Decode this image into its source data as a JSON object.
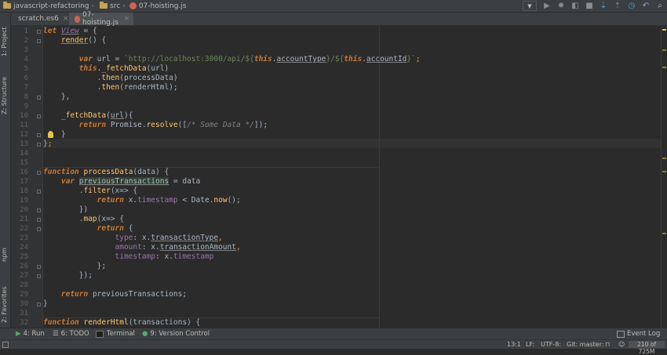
{
  "breadcrumb": {
    "project": "javascript-refactoring",
    "folder": "src",
    "file": "07-hoisting.js"
  },
  "tabs": [
    {
      "label": "scratch.es6",
      "icon": "es6-file-icon"
    },
    {
      "label": "07-hoisting.js",
      "icon": "js-file-icon"
    }
  ],
  "left_tools": {
    "project": "1: Project",
    "structure": "Z: Structure",
    "npm": "npm",
    "favorites": "2: Favorites"
  },
  "line_numbers": [
    "1",
    "2",
    "3",
    "4",
    "5",
    "6",
    "7",
    "8",
    "9",
    "10",
    "11",
    "12",
    "13",
    "14",
    "15",
    "16",
    "17",
    "18",
    "19",
    "20",
    "21",
    "22",
    "23",
    "24",
    "25",
    "26",
    "27",
    "28",
    "29",
    "30",
    "31",
    "32"
  ],
  "code": {
    "l1_a": "let ",
    "l1_b": "View",
    "l1_c": " = {",
    "l2_a": "    ",
    "l2_b": "render",
    "l2_c": "() {",
    "l4_a": "        ",
    "l4_b": "var",
    "l4_c": " url = ",
    "l4_d": "`http://localhost:3000/api/${",
    "l4_e": "this",
    "l4_f": ".",
    "l4_g": "accountType",
    "l4_h": "}/${",
    "l4_i": "this",
    "l4_j": ".",
    "l4_k": "accountId",
    "l4_l": "}`",
    "l4_m": ";",
    "l5_a": "        ",
    "l5_b": "this",
    "l5_c": ".",
    "l5_d": "_fetchData",
    "l5_e": "(url)",
    "l6_a": "            .",
    "l6_b": "then",
    "l6_c": "(processData)",
    "l7_a": "            .",
    "l7_b": "then",
    "l7_c": "(renderHtml);",
    "l8": "    },",
    "l10_a": "    ",
    "l10_b": "_fetchData",
    "l10_c": "(",
    "l10_d": "url",
    "l10_e": "){",
    "l11_a": "        ",
    "l11_b": "return",
    "l11_c": " Promise.",
    "l11_d": "resolve",
    "l11_e": "([",
    "l11_f": "/* Some Data */",
    "l11_g": "]);",
    "l12": "    }",
    "l13_a": "}",
    "l13_b": ";",
    "l16_a": "function",
    "l16_b": " ",
    "l16_c": "processData",
    "l16_d": "(data) {",
    "l17_a": "    ",
    "l17_b": "var",
    "l17_c": " ",
    "l17_d": "previousTransactions",
    "l17_e": " = data",
    "l18_a": "        .",
    "l18_b": "filter",
    "l18_c": "(x=> {",
    "l19_a": "            ",
    "l19_b": "return",
    "l19_c": " x.",
    "l19_d": "timestamp",
    "l19_e": " < Date.",
    "l19_f": "now",
    "l19_g": "();",
    "l20": "        })",
    "l21_a": "        .",
    "l21_b": "map",
    "l21_c": "(x=> {",
    "l22_a": "            ",
    "l22_b": "return",
    "l22_c": " {",
    "l23_a": "                ",
    "l23_b": "type",
    "l23_c": ": x.",
    "l23_d": "transactionType",
    "l23_e": ",",
    "l24_a": "                ",
    "l24_b": "amount",
    "l24_c": ": x.",
    "l24_d": "transactionAmount",
    "l24_e": ",",
    "l25_a": "                ",
    "l25_b": "timestamp",
    "l25_c": ": x.",
    "l25_d": "timestamp",
    "l26": "            };",
    "l27": "        });",
    "l29_a": "    ",
    "l29_b": "return",
    "l29_c": " previousTransactions;",
    "l30": "}",
    "l32_a": "function",
    "l32_b": " ",
    "l32_c": "renderHtml",
    "l32_d": "(transactions) {"
  },
  "bottom_tools": {
    "run": "4: Run",
    "todo": "6: TODO",
    "terminal": "Terminal",
    "vcs": "9: Version Control",
    "event_log": "Event Log"
  },
  "status": {
    "position": "13:1",
    "line_sep": "LF:",
    "encoding": "UTF-8:",
    "git": "Git: master:",
    "memory": "210 of 725M"
  },
  "colors": {
    "keyword": "#cc7832",
    "function": "#ffc66d",
    "string": "#6a8759",
    "property": "#9876aa",
    "comment": "#808080",
    "text": "#a9b7c6",
    "background": "#2b2b2b"
  }
}
